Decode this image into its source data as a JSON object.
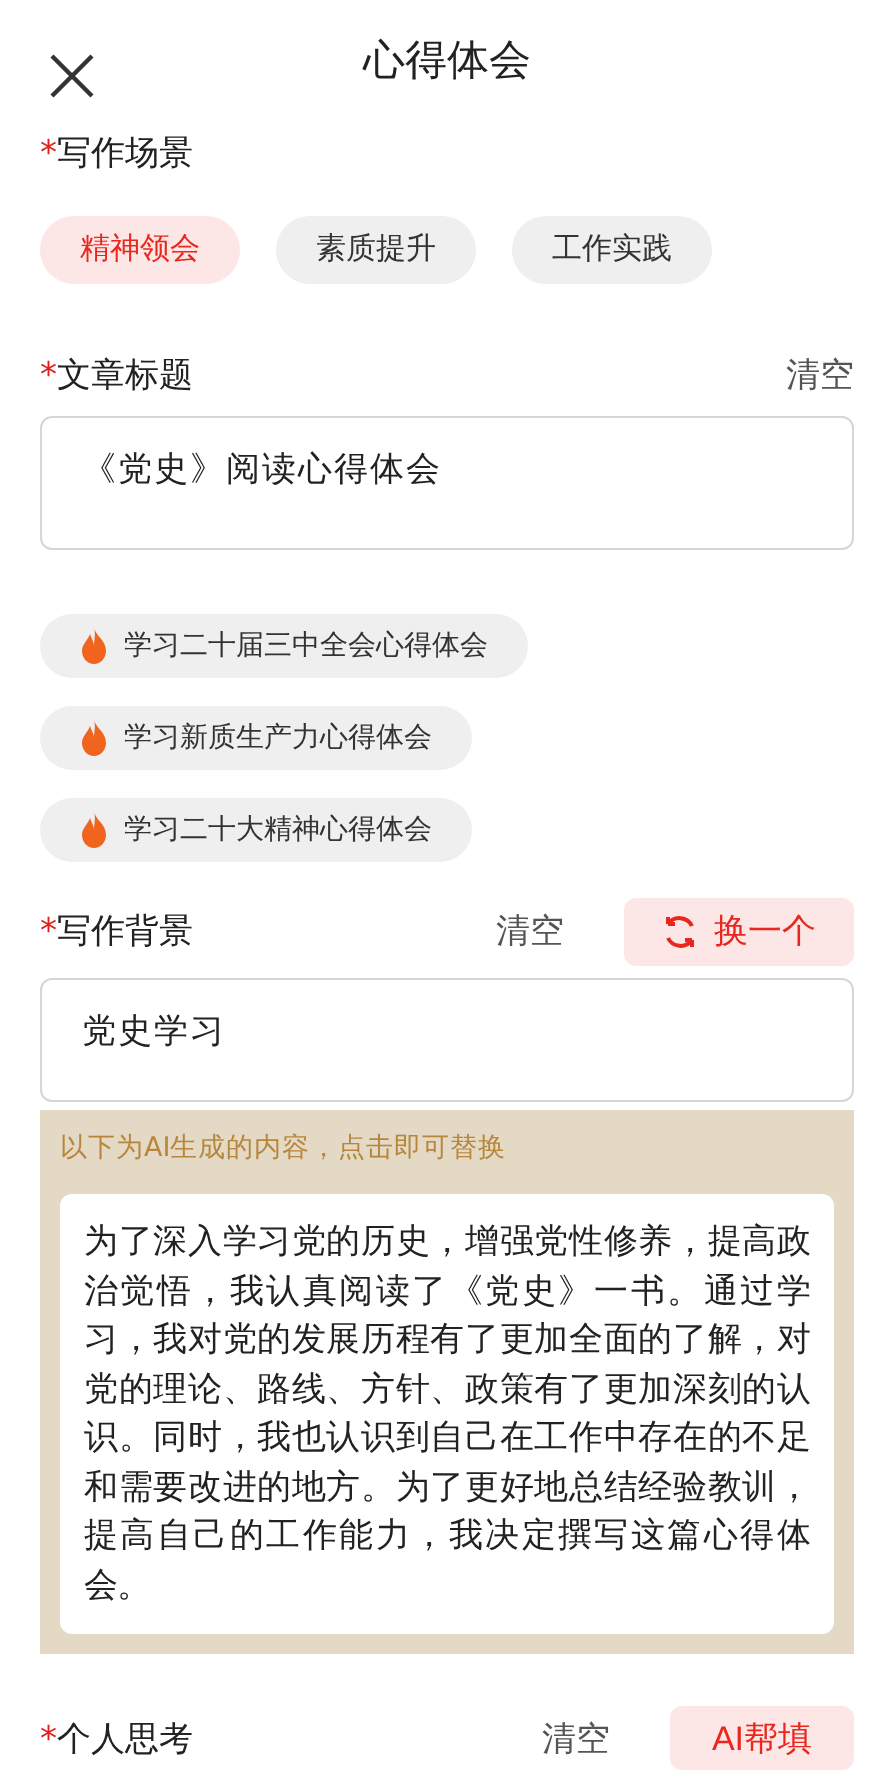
{
  "header": {
    "title": "心得体会"
  },
  "scene": {
    "mark": "*",
    "label": "写作场景",
    "options": [
      {
        "label": "精神领会",
        "selected": true
      },
      {
        "label": "素质提升",
        "selected": false
      },
      {
        "label": "工作实践",
        "selected": false
      }
    ]
  },
  "article_title": {
    "mark": "*",
    "label": "文章标题",
    "clear": "清空",
    "value": "《党史》阅读心得体会"
  },
  "suggestions": [
    "学习二十届三中全会心得体会",
    "学习新质生产力心得体会",
    "学习二十大精神心得体会"
  ],
  "background": {
    "mark": "*",
    "label": "写作背景",
    "clear": "清空",
    "swap": "换一个",
    "value": "党史学习"
  },
  "ai": {
    "hint": "以下为AI生成的内容，点击即可替换",
    "text": "为了深入学习党的历史，增强党性修养，提高政治觉悟，我认真阅读了《党史》一书。通过学习，我对党的发展历程有了更加全面的了解，对党的理论、路线、方针、政策有了更加深刻的认识。同时，我也认识到自己在工作中存在的不足和需要改进的地方。为了更好地总结经验教训，提高自己的工作能力，我决定撰写这篇心得体会。"
  },
  "thinking": {
    "mark": "*",
    "label": "个人思考",
    "clear": "清空",
    "fill": "AI帮填"
  }
}
